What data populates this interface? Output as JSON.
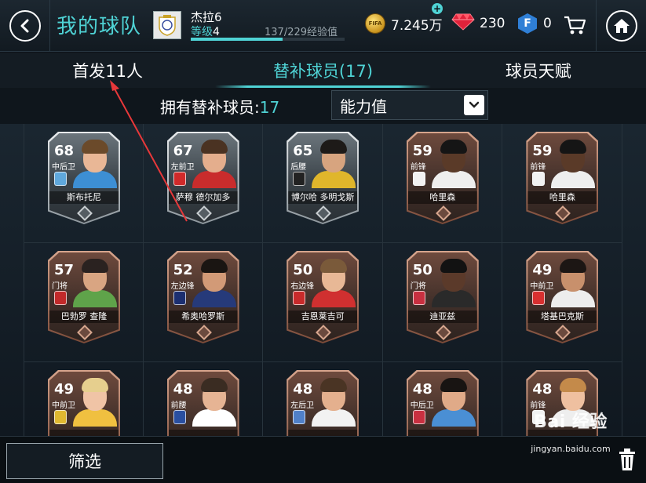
{
  "header": {
    "title": "我的球队",
    "team_name": "杰拉6",
    "level_label": "等级",
    "level_value": "4",
    "exp_text": "137/229经验值",
    "exp_progress": 0.598,
    "coins": "7.245万",
    "gems": "230",
    "fifa_points": "0"
  },
  "tabs": [
    {
      "label": "首发11人",
      "active": false
    },
    {
      "label": "替补球员(17)",
      "active": true
    },
    {
      "label": "球员天赋",
      "active": false
    }
  ],
  "filter": {
    "owned_label": "拥有替补球员:",
    "owned_count": "17",
    "sort_value": "能力值"
  },
  "players": [
    {
      "rating": "68",
      "position": "中后卫",
      "name": "斯布托尼",
      "tier": "silver",
      "badge_color": "#5fa8dc",
      "hair": "#6b4a2a",
      "skin": "#e9b796",
      "shirt": "#3d8fd4"
    },
    {
      "rating": "67",
      "position": "左前卫",
      "name": "萨穆 德尔加多",
      "tier": "silver",
      "badge_color": "#d02a2a",
      "hair": "#4a3222",
      "skin": "#e4ae8d",
      "shirt": "#c92c2c"
    },
    {
      "rating": "65",
      "position": "后腰",
      "name": "博尔哈 多明戈斯",
      "tier": "silver",
      "badge_color": "#222222",
      "hair": "#1d1a18",
      "skin": "#d7a47f",
      "shirt": "#e0b62b"
    },
    {
      "rating": "59",
      "position": "前锋",
      "name": "哈里森",
      "tier": "bronze",
      "badge_color": "#f2f2f2",
      "hair": "#151515",
      "skin": "#5a3a28",
      "shirt": "#eeeeee"
    },
    {
      "rating": "59",
      "position": "前锋",
      "name": "哈里森",
      "tier": "bronze",
      "badge_color": "#f2f2f2",
      "hair": "#151515",
      "skin": "#5a3a28",
      "shirt": "#eeeeee"
    },
    {
      "rating": "57",
      "position": "门将",
      "name": "巴勃罗 查隆",
      "tier": "bronze",
      "badge_color": "#c22a2a",
      "hair": "#2a2220",
      "skin": "#d9a582",
      "shirt": "#5fa34a"
    },
    {
      "rating": "52",
      "position": "左边锋",
      "name": "希奥哈罗斯",
      "tier": "bronze",
      "badge_color": "#1c2f70",
      "hair": "#1a1512",
      "skin": "#d29a77",
      "shirt": "#263a7a"
    },
    {
      "rating": "50",
      "position": "右边锋",
      "name": "吉恩莱吉可",
      "tier": "bronze",
      "badge_color": "#c82b2b",
      "hair": "#7a5a3a",
      "skin": "#e8b896",
      "shirt": "#d03030"
    },
    {
      "rating": "50",
      "position": "门将",
      "name": "迪亚兹",
      "tier": "bronze",
      "badge_color": "#c83040",
      "hair": "#121212",
      "skin": "#5b3a2a",
      "shirt": "#2a2a2a"
    },
    {
      "rating": "49",
      "position": "中前卫",
      "name": "塔基巴克斯",
      "tier": "bronze",
      "badge_color": "#d83030",
      "hair": "#1c1614",
      "skin": "#c8906c",
      "shirt": "#ededed"
    },
    {
      "rating": "49",
      "position": "中前卫",
      "name": "",
      "tier": "bronze",
      "badge_color": "#e0b830",
      "hair": "#e6cf8e",
      "skin": "#f0c4a6",
      "shirt": "#f0c040"
    },
    {
      "rating": "48",
      "position": "前腰",
      "name": "",
      "tier": "bronze",
      "badge_color": "#2a4fa0",
      "hair": "#3a2c22",
      "skin": "#e6b494",
      "shirt": "#ffffff"
    },
    {
      "rating": "48",
      "position": "左后卫",
      "name": "",
      "tier": "bronze",
      "badge_color": "#5080c8",
      "hair": "#4a3424",
      "skin": "#e4b08e",
      "shirt": "#f2f2f2"
    },
    {
      "rating": "48",
      "position": "中后卫",
      "name": "",
      "tier": "bronze",
      "badge_color": "#c83040",
      "hair": "#181412",
      "skin": "#e0aa88",
      "shirt": "#4a8fd4"
    },
    {
      "rating": "48",
      "position": "前锋",
      "name": "",
      "tier": "bronze",
      "badge_color": "#f2f2f2",
      "hair": "#c48a4a",
      "skin": "#efc0a0",
      "shirt": "#eeeeee"
    }
  ],
  "bottom": {
    "filter_button": "筛选"
  },
  "watermark": {
    "logo": "Bai 经验",
    "url": "jingyan.baidu.com"
  },
  "colors": {
    "accent": "#4fd3d5",
    "annotation_arrow": "#e8383a"
  }
}
